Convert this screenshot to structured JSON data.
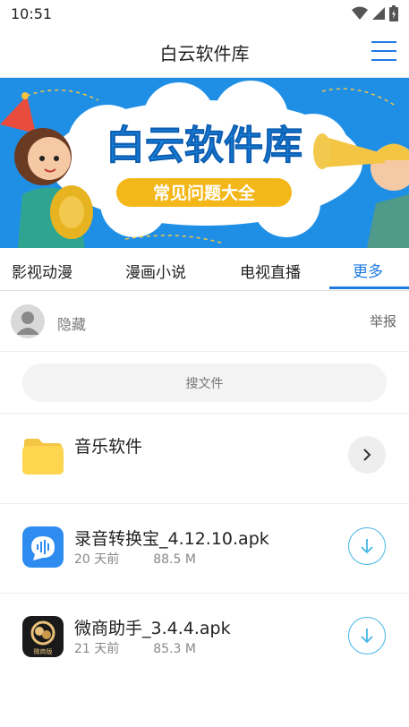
{
  "status": {
    "time": "10:51"
  },
  "header": {
    "title": "白云软件库"
  },
  "banner": {
    "title": "白云软件库",
    "subtitle": "常见问题大全"
  },
  "tabs": [
    {
      "label": "影视动漫"
    },
    {
      "label": "漫画小说"
    },
    {
      "label": "电视直播"
    },
    {
      "label": "更多"
    }
  ],
  "user": {
    "name": "隐藏",
    "report_label": "举报"
  },
  "search": {
    "placeholder": "搜文件"
  },
  "folder": {
    "name": "音乐软件"
  },
  "files": [
    {
      "name": "录音转换宝_4.12.10.apk",
      "age": "20 天前",
      "size": "88.5 M"
    },
    {
      "name": "微商助手_3.4.4.apk",
      "age": "21 天前",
      "size": "85.3 M",
      "icon_text": "微商版"
    }
  ],
  "colors": {
    "accent": "#1f7ae0",
    "banner_bg": "#1f8fe6",
    "download": "#45b7e8",
    "folder": "#fdd54f"
  }
}
